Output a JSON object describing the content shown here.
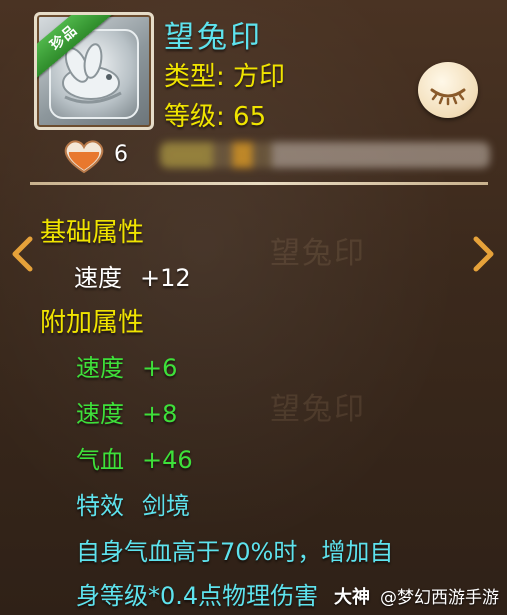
{
  "item": {
    "name": "望兔印",
    "badge": "珍品",
    "type_line": "类型: 方印",
    "level_line": "等级: 65",
    "heart_count": "6"
  },
  "basic_section": {
    "title": "基础属性",
    "stats": [
      {
        "label": "速度",
        "value": "+12"
      }
    ]
  },
  "extra_section": {
    "title": "附加属性",
    "stats": [
      {
        "label": "速度",
        "value": "+6"
      },
      {
        "label": "速度",
        "value": "+8"
      },
      {
        "label": "气血",
        "value": "+46"
      }
    ],
    "effect": {
      "label": "特效",
      "value": "剑境"
    },
    "effect_desc_line1": "自身气血高于70%时，增加自",
    "effect_desc_line2": "身等级*0.4点物理伤害"
  },
  "watermark": {
    "logo": "大神",
    "text": "@梦幻西游手游"
  },
  "colors": {
    "title": "#5ee3ee",
    "section": "#f0e400",
    "extra_stat": "#3ee03a",
    "basic_stat": "#ffffff",
    "description": "#5ee3ee"
  },
  "icons": [
    "rabbit-seal-icon",
    "eye-closed-icon",
    "heart-icon",
    "arrow-left-icon",
    "arrow-right-icon"
  ]
}
